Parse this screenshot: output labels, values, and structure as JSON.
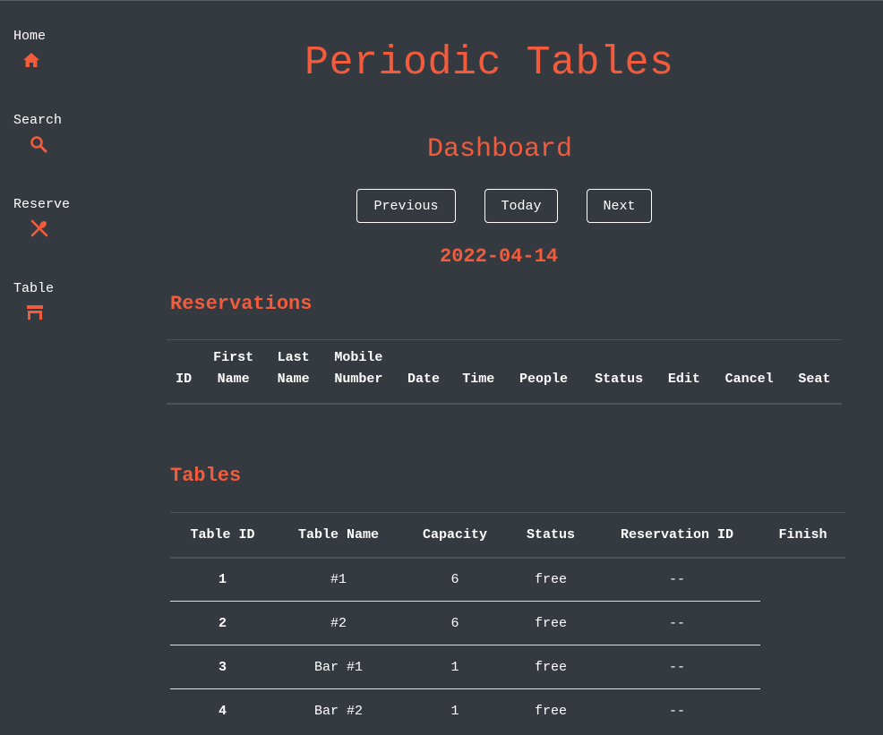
{
  "sidebar": {
    "items": [
      {
        "label": "Home",
        "icon": "home-icon"
      },
      {
        "label": "Search",
        "icon": "search-icon"
      },
      {
        "label": "Reserve",
        "icon": "utensils-icon"
      },
      {
        "label": "Table",
        "icon": "table-icon"
      }
    ]
  },
  "header": {
    "title": "Periodic Tables",
    "subtitle": "Dashboard"
  },
  "date_nav": {
    "previous": "Previous",
    "today": "Today",
    "next": "Next",
    "current_date": "2022-04-14"
  },
  "reservations": {
    "heading": "Reservations",
    "columns": [
      [
        "",
        "ID"
      ],
      [
        "First",
        "Name"
      ],
      [
        "Last",
        "Name"
      ],
      [
        "Mobile",
        "Number"
      ],
      [
        "",
        "Date"
      ],
      [
        "",
        "Time"
      ],
      [
        "",
        "People"
      ],
      [
        "",
        "Status"
      ],
      [
        "",
        "Edit"
      ],
      [
        "",
        "Cancel"
      ],
      [
        "",
        "Seat"
      ]
    ],
    "rows": []
  },
  "tables": {
    "heading": "Tables",
    "columns": [
      "Table ID",
      "Table Name",
      "Capacity",
      "Status",
      "Reservation ID",
      "Finish"
    ],
    "rows": [
      {
        "id": "1",
        "name": "#1",
        "capacity": "6",
        "status": "free",
        "reservation_id": "--"
      },
      {
        "id": "2",
        "name": "#2",
        "capacity": "6",
        "status": "free",
        "reservation_id": "--"
      },
      {
        "id": "3",
        "name": "Bar #1",
        "capacity": "1",
        "status": "free",
        "reservation_id": "--"
      },
      {
        "id": "4",
        "name": "Bar #2",
        "capacity": "1",
        "status": "free",
        "reservation_id": "--"
      }
    ]
  },
  "colors": {
    "background": "#343a40",
    "accent": "#f25c3c",
    "text": "#ffffff"
  }
}
